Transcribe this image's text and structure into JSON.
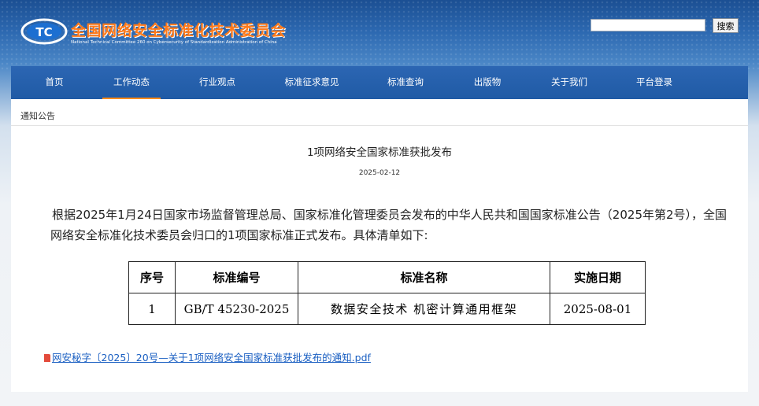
{
  "header": {
    "logo_text": "TC",
    "title": "全国网络安全标准化技术委员会",
    "subtitle": "National Technical Committee 260 on Cybersecurity of Standardization Administration of China",
    "search_placeholder": "",
    "search_button": "搜索"
  },
  "nav": {
    "items": [
      {
        "label": "首页"
      },
      {
        "label": "工作动态"
      },
      {
        "label": "行业观点"
      },
      {
        "label": "标准征求意见"
      },
      {
        "label": "标准查询"
      },
      {
        "label": "出版物"
      },
      {
        "label": "关于我们"
      },
      {
        "label": "平台登录"
      }
    ],
    "active_index": 1
  },
  "breadcrumb": "通知公告",
  "article": {
    "title": "1项网络安全国家标准获批发布",
    "date": "2025-02-12",
    "body": "根据2025年1月24日国家市场监督管理总局、国家标准化管理委员会发布的中华人民共和国国家标准公告（2025年第2号），全国网络安全标准化技术委员会归口的1项国家标准正式发布。具体清单如下:"
  },
  "table": {
    "headers": [
      "序号",
      "标准编号",
      "标准名称",
      "实施日期"
    ],
    "rows": [
      [
        "1",
        "GB/T 45230-2025",
        "数据安全技术 机密计算通用框架",
        "2025-08-01"
      ]
    ]
  },
  "attachment": {
    "icon": "pdf-icon",
    "label": "网安秘字〔2025〕20号—关于1项网络安全国家标准获批发布的通知.pdf"
  },
  "colors": {
    "nav_bg": "#2161ad",
    "brand_orange": "#ff7a1a",
    "link": "#1a5fc2"
  }
}
